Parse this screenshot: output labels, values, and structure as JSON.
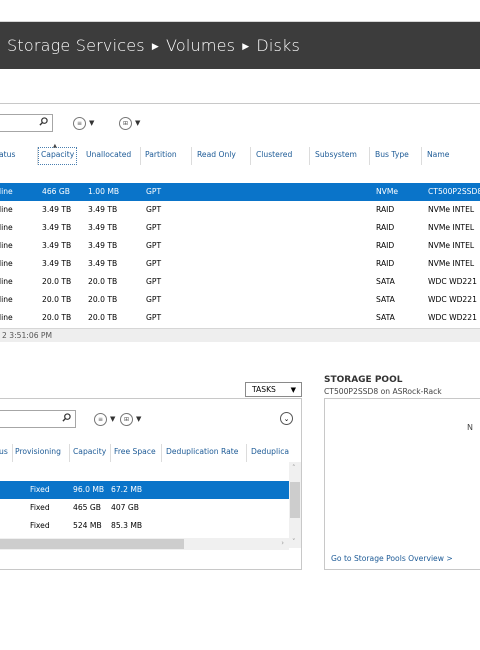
{
  "breadcrumb": [
    "Storage Services",
    "Volumes",
    "Disks"
  ],
  "disks": {
    "columns": [
      "atus",
      "Capacity",
      "Unallocated",
      "Partition",
      "Read Only",
      "Clustered",
      "Subsystem",
      "Bus Type",
      "Name"
    ],
    "rows": [
      {
        "status": "line",
        "capacity": "466 GB",
        "unallocated": "1.00 MB",
        "partition": "GPT",
        "bus": "NVMe",
        "name": "CT500P2SSD8",
        "selected": true
      },
      {
        "status": "line",
        "capacity": "3.49 TB",
        "unallocated": "3.49 TB",
        "partition": "GPT",
        "bus": "RAID",
        "name": "NVMe INTEL"
      },
      {
        "status": "line",
        "capacity": "3.49 TB",
        "unallocated": "3.49 TB",
        "partition": "GPT",
        "bus": "RAID",
        "name": "NVMe INTEL"
      },
      {
        "status": "line",
        "capacity": "3.49 TB",
        "unallocated": "3.49 TB",
        "partition": "GPT",
        "bus": "RAID",
        "name": "NVMe INTEL"
      },
      {
        "status": "line",
        "capacity": "3.49 TB",
        "unallocated": "3.49 TB",
        "partition": "GPT",
        "bus": "RAID",
        "name": "NVMe INTEL"
      },
      {
        "status": "line",
        "capacity": "20.0 TB",
        "unallocated": "20.0 TB",
        "partition": "GPT",
        "bus": "SATA",
        "name": "WDC WD221"
      },
      {
        "status": "line",
        "capacity": "20.0 TB",
        "unallocated": "20.0 TB",
        "partition": "GPT",
        "bus": "SATA",
        "name": "WDC WD221"
      },
      {
        "status": "line",
        "capacity": "20.0 TB",
        "unallocated": "20.0 TB",
        "partition": "GPT",
        "bus": "SATA",
        "name": "WDC WD221"
      }
    ],
    "status_text": "2 3:51:06 PM"
  },
  "tasks_label": "TASKS",
  "vdisks": {
    "columns": [
      "us",
      "Provisioning",
      "Capacity",
      "Free Space",
      "Deduplication Rate",
      "Deduplica"
    ],
    "rows": [
      {
        "provisioning": "Fixed",
        "capacity": "96.0 MB",
        "free": "67.2 MB",
        "selected": true
      },
      {
        "provisioning": "Fixed",
        "capacity": "465 GB",
        "free": "407 GB"
      },
      {
        "provisioning": "Fixed",
        "capacity": "524 MB",
        "free": "85.3 MB"
      }
    ]
  },
  "pool": {
    "title": "STORAGE POOL",
    "subtitle": "CT500P2SSD8 on ASRock-Rack",
    "letter": "N",
    "link": "Go to Storage Pools Overview >"
  },
  "colors": {
    "accent": "#0a74c9",
    "titlebar": "#3c3c3c",
    "link": "#1c5a96"
  }
}
